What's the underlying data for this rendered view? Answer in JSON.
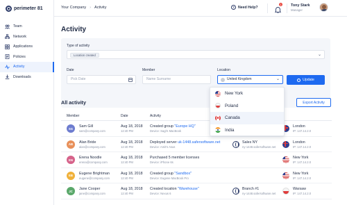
{
  "app": {
    "brand": "perimeter 81"
  },
  "sidebar": {
    "items": [
      {
        "label": "Team",
        "icon": "team-icon",
        "active": false
      },
      {
        "label": "Network",
        "icon": "network-icon",
        "active": false
      },
      {
        "label": "Applications",
        "icon": "applications-icon",
        "active": false
      },
      {
        "label": "Policies",
        "icon": "policies-icon",
        "active": false
      },
      {
        "label": "Activity",
        "icon": "activity-icon",
        "active": true
      },
      {
        "label": "Downloads",
        "icon": "downloads-icon",
        "active": false
      }
    ]
  },
  "topbar": {
    "breadcrumb": [
      "Your Company",
      "Activity"
    ],
    "help_label": "Need Help?",
    "notifications_count": "1",
    "user": {
      "name": "Tony Stark",
      "role": "Manager"
    }
  },
  "page": {
    "title": "Activity"
  },
  "filters": {
    "type_label": "Type of activity",
    "type_chip": "Location created",
    "date_label": "Date",
    "date_placeholder": "Pick Date",
    "member_label": "Member",
    "member_placeholder": "Name Surname",
    "location_label": "Location",
    "location_value": "United Kingdom",
    "update_label": "Update"
  },
  "location_dropdown": {
    "options": [
      {
        "label": "New York",
        "flag": "us"
      },
      {
        "label": "Poland",
        "flag": "pl"
      },
      {
        "label": "Canada",
        "flag": "ca"
      },
      {
        "label": "India",
        "flag": "in"
      }
    ]
  },
  "activity": {
    "title": "All activity",
    "export_label": "Export Activity",
    "columns": [
      "Member",
      "Date",
      "Activity"
    ],
    "rows": [
      {
        "initials": "SG",
        "color": "#6d7ccf",
        "name": "Sam Gill",
        "email": "sam@company.com",
        "date": "Aug 18, 2018",
        "time": "12:40 PM",
        "action": "Created group",
        "target": "\"Europe HQ\"",
        "device": "Device: Sagi's MacBook",
        "endpoint": "",
        "endpoint_sub": "",
        "location": "London",
        "ip": "IP: 147.14.2.0",
        "flag": "uk",
        "globe": false
      },
      {
        "initials": "AB",
        "color": "#e8905a",
        "name": "Alan Bride",
        "email": "alan@company.com",
        "date": "Aug 18, 2018",
        "time": "12:40 PM",
        "action": "Deployed server",
        "target": "uk-1448.safersoftware.net",
        "device": "Device: Amit's Asus",
        "endpoint": "Sales NY",
        "endpoint_sub": "ny-1448.safersoftware.net",
        "location": "London",
        "ip": "IP: 147.14.2.0",
        "flag": "uk",
        "globe": true
      },
      {
        "initials": "EN",
        "color": "#d6628a",
        "name": "Erena Noodle",
        "email": "erena@company.com",
        "date": "Aug 18, 2018",
        "time": "12:40 PM",
        "action": "Purchased 5 member licenses",
        "target": "",
        "device": "Device: iPhone 6s",
        "endpoint": "",
        "endpoint_sub": "",
        "location": "New York",
        "ip": "IP: 147.14.2.0",
        "flag": "us",
        "globe": false
      },
      {
        "initials": "EB",
        "color": "#f0b13a",
        "name": "Eugene Brightman",
        "email": "eugene@company.com",
        "date": "Aug 18, 2018",
        "time": "12:40 PM",
        "action": "Created group",
        "target": "\"Sandbox\"",
        "device": "Device: Eugene MacBook Pro",
        "endpoint": "",
        "endpoint_sub": "",
        "location": "New York",
        "ip": "IP: 147.14.2.0",
        "flag": "us",
        "globe": false
      },
      {
        "initials": "JC",
        "color": "#5aa86a",
        "name": "Jane Cooper",
        "email": "jane@company.com",
        "date": "Aug 18, 2018",
        "time": "12:40 PM",
        "action": "Created location",
        "target": "\"Warehouse\"",
        "device": "Device: Nexus 6",
        "endpoint": "Branch #1",
        "endpoint_sub": "ny-1448.safersoftware.net",
        "location": "Warsaw",
        "ip": "IP: 147.14.2.0",
        "flag": "pl",
        "globe": true
      }
    ]
  }
}
